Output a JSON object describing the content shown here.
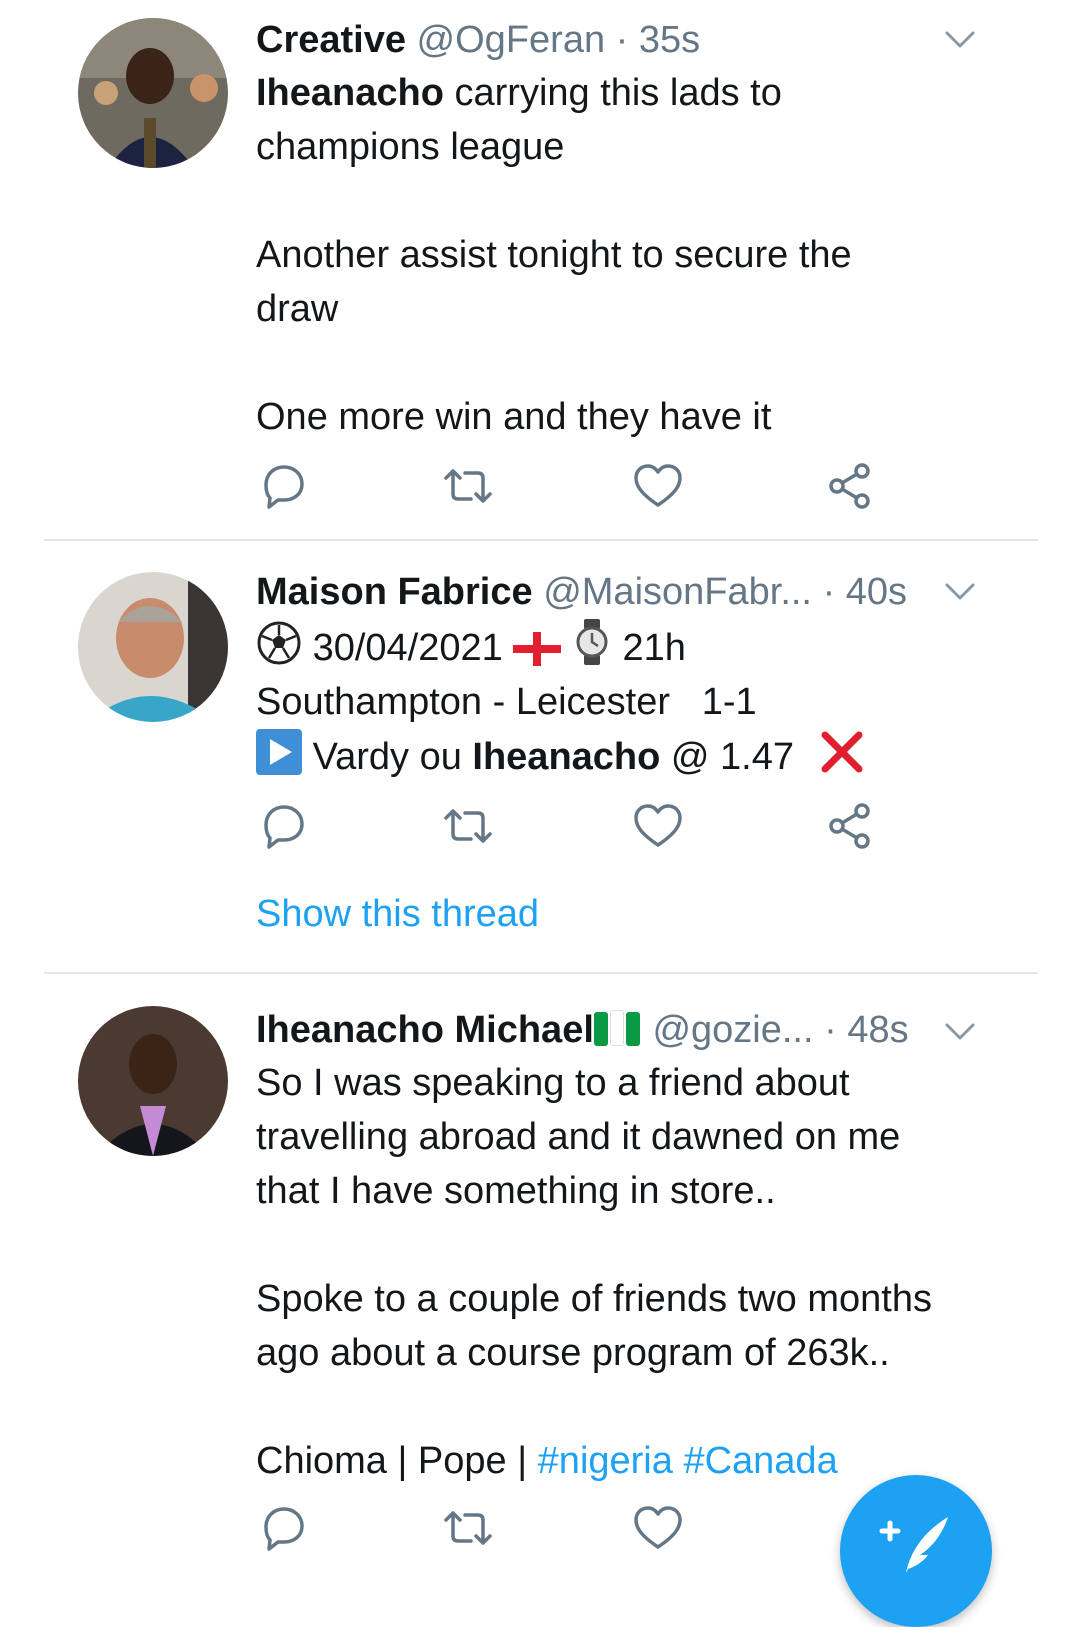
{
  "tweets": [
    {
      "name": "Creative",
      "handle": "@OgFeran",
      "time": "35s",
      "bold_lead": "Iheanacho",
      "line1_rest": " carrying this lads to",
      "line2": "champions league",
      "para2_l1": "Another assist tonight to secure the",
      "para2_l2": "draw",
      "para3": "One more win and they have it"
    },
    {
      "name": "Maison Fabrice",
      "handle": "@MaisonFabr...",
      "time": "40s",
      "date": "30/04/2021",
      "hour": "21h",
      "match": "Southampton - Leicester",
      "score": "1-1",
      "pick_prefix": "Vardy ou ",
      "pick_bold": "Iheanacho",
      "pick_odds": " @ 1.47",
      "show_thread": "Show this thread"
    },
    {
      "name": "Iheanacho Michael",
      "handle": "@gozie...",
      "time": "48s",
      "p1_l1": "So I was speaking to a friend about",
      "p1_l2": "travelling abroad and it dawned on me",
      "p1_l3": "that I have something in store..",
      "p2_l1": "Spoke to a couple of friends two months",
      "p2_l2": "ago about a course program of 263k..",
      "p3_plain": "Chioma | Pope | ",
      "hashtag1": "#nigeria",
      "hashtag2": "#Canada"
    }
  ],
  "colors": {
    "accent": "#1da1f2",
    "muted": "#657786",
    "text": "#14171a",
    "divider": "#e1e8ed"
  },
  "icons": [
    "reply-icon",
    "retweet-icon",
    "like-icon",
    "share-icon",
    "chevron-down-icon",
    "compose-tweet-icon"
  ]
}
